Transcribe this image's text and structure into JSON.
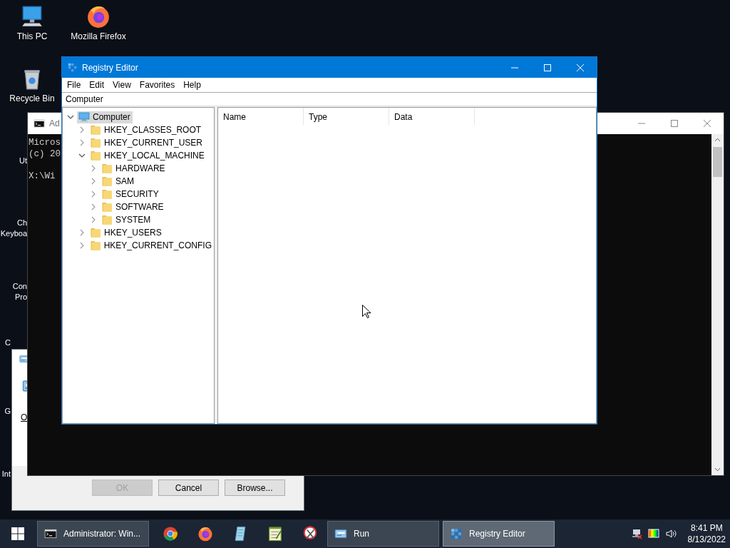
{
  "desktop": {
    "icons": [
      {
        "label": "This PC",
        "kind": "pc"
      },
      {
        "label": "Mozilla Firefox",
        "kind": "firefox"
      },
      {
        "label": "Recycle Bin",
        "kind": "bin"
      }
    ],
    "partial_labels": [
      "Ut",
      "Ch",
      "Keyboa",
      "Con",
      "Pro",
      "C",
      "G",
      "Int"
    ]
  },
  "console_window": {
    "title": "Ad",
    "lines": [
      "Micros",
      "(c) 20",
      "X:\\Wi"
    ]
  },
  "run_dialog": {
    "open_label": "O",
    "buttons": [
      {
        "label": "OK",
        "disabled": true
      },
      {
        "label": "Cancel",
        "disabled": false
      },
      {
        "label": "Browse...",
        "disabled": false
      }
    ]
  },
  "registry_editor": {
    "title": "Registry Editor",
    "menu": [
      "File",
      "Edit",
      "View",
      "Favorites",
      "Help"
    ],
    "address": "Computer",
    "tree": [
      {
        "label": "Computer",
        "kind": "computer",
        "expanded": true,
        "selected": true,
        "children": [
          {
            "label": "HKEY_CLASSES_ROOT",
            "kind": "folder",
            "expanded": false,
            "selected": false
          },
          {
            "label": "HKEY_CURRENT_USER",
            "kind": "folder",
            "expanded": false,
            "selected": false
          },
          {
            "label": "HKEY_LOCAL_MACHINE",
            "kind": "folder",
            "expanded": true,
            "selected": false,
            "children": [
              {
                "label": "HARDWARE",
                "kind": "folder",
                "expanded": false,
                "selected": false
              },
              {
                "label": "SAM",
                "kind": "folder",
                "expanded": false,
                "selected": false
              },
              {
                "label": "SECURITY",
                "kind": "folder",
                "expanded": false,
                "selected": false
              },
              {
                "label": "SOFTWARE",
                "kind": "folder",
                "expanded": false,
                "selected": false
              },
              {
                "label": "SYSTEM",
                "kind": "folder",
                "expanded": false,
                "selected": false
              }
            ]
          },
          {
            "label": "HKEY_USERS",
            "kind": "folder",
            "expanded": false,
            "selected": false
          },
          {
            "label": "HKEY_CURRENT_CONFIG",
            "kind": "folder",
            "expanded": false,
            "selected": false
          }
        ]
      }
    ],
    "columns": [
      "Name",
      "Type",
      "Data"
    ]
  },
  "taskbar": {
    "items": [
      {
        "kind": "cmd",
        "label": "Administrator: Win...",
        "selected": false
      },
      {
        "kind": "chrome",
        "selected": false
      },
      {
        "kind": "firefox",
        "selected": false
      },
      {
        "kind": "notepad",
        "selected": false
      },
      {
        "kind": "editor",
        "selected": false
      },
      {
        "kind": "snip",
        "selected": false
      },
      {
        "kind": "run",
        "label": "Run",
        "selected": false
      },
      {
        "kind": "regedit",
        "label": "Registry Editor",
        "selected": true
      }
    ],
    "clock": {
      "time": "8:41 PM",
      "date": "8/13/2022"
    }
  }
}
